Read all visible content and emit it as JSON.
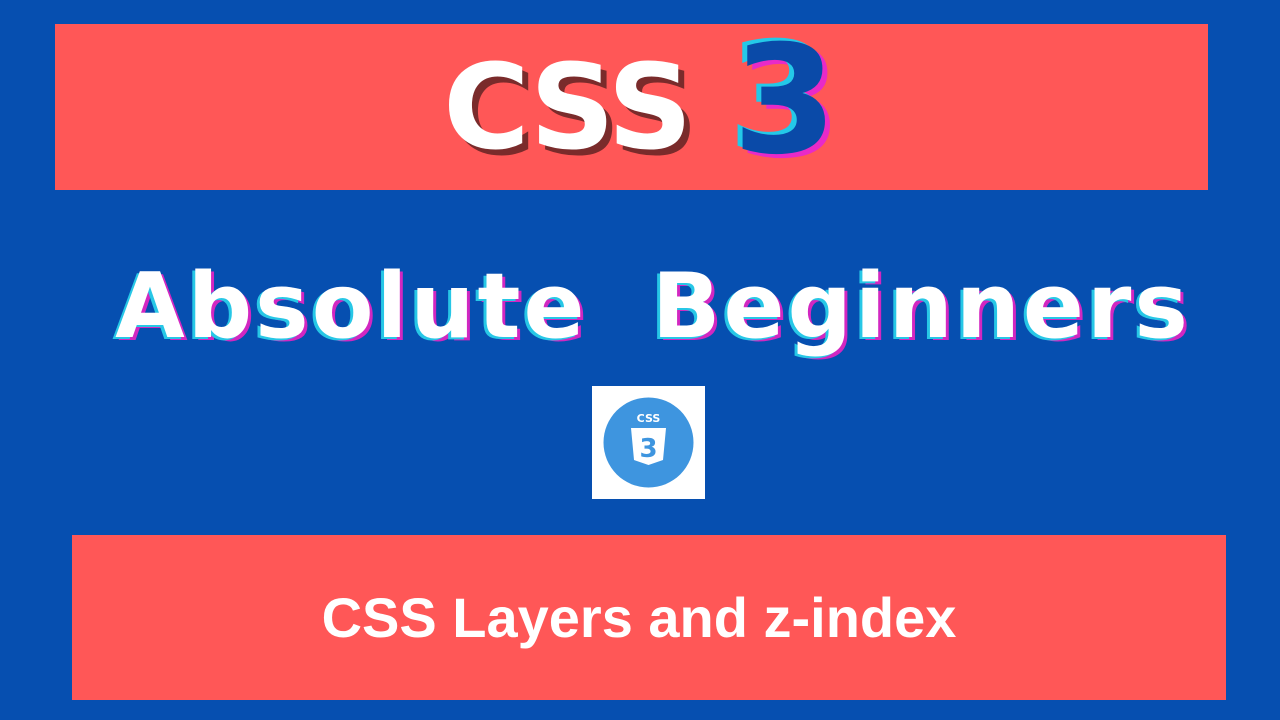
{
  "colors": {
    "background": "#064fb0",
    "banner": "#ff5757",
    "text": "#ffffff",
    "accent_number": "#0a4aa8",
    "logo_circle": "#3e95df"
  },
  "banner_top": {
    "title": "CSS",
    "number": "3"
  },
  "subtitle": "Absolute  Beginners",
  "logo": {
    "icon": "css3-logo-icon",
    "label": "CSS",
    "number": "3"
  },
  "banner_bottom": {
    "lesson_title": "CSS Layers and z-index"
  }
}
